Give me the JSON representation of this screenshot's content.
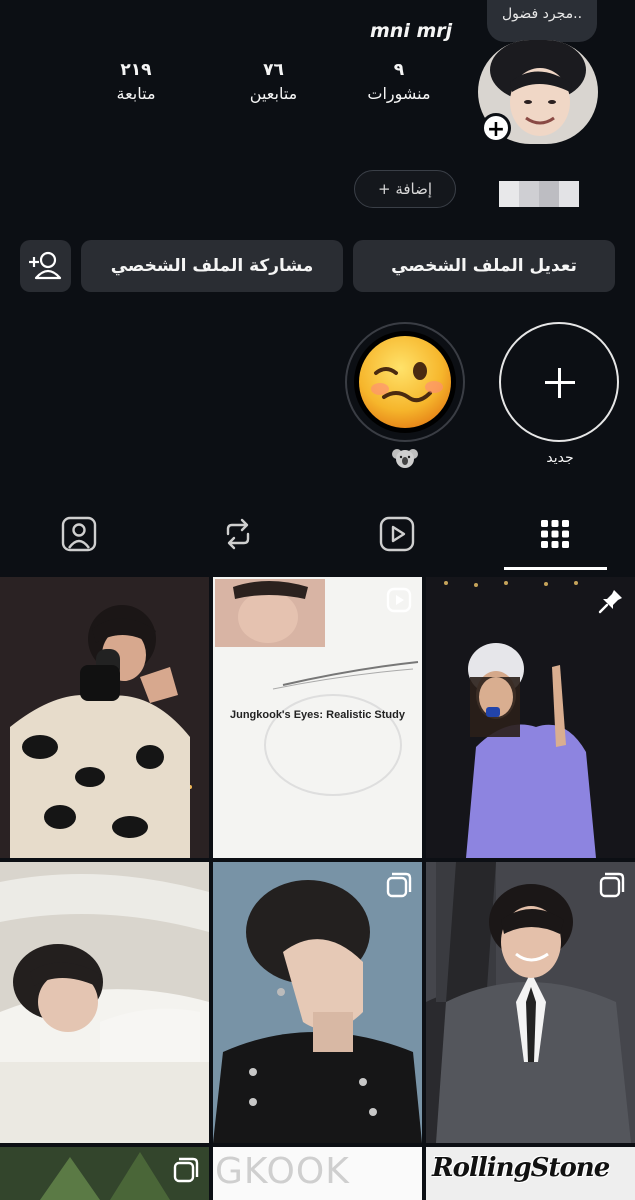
{
  "note": {
    "text": "مجرد فضول.."
  },
  "profile": {
    "username": "mni mrj",
    "stats": {
      "posts": {
        "count": "٩",
        "label": "منشورات"
      },
      "followers": {
        "count": "٧٦",
        "label": "متابعين"
      },
      "following": {
        "count": "٢١٩",
        "label": "متابعة"
      }
    },
    "add_label": "+ إضافة",
    "avatar_add": "+"
  },
  "actions": {
    "edit_profile": "تعديل الملف الشخصي",
    "share_profile": "مشاركة الملف الشخصي",
    "discover_icon": "add-person-icon"
  },
  "stories": {
    "new_label": "جديد",
    "highlight_label_icon": "koala-emoji"
  },
  "tabs": [
    {
      "name": "grid",
      "icon": "grid-icon",
      "active": true
    },
    {
      "name": "reels",
      "icon": "reels-icon",
      "active": false
    },
    {
      "name": "reposts",
      "icon": "repost-icon",
      "active": false
    },
    {
      "name": "tagged",
      "icon": "tagged-icon",
      "active": false
    }
  ],
  "posts": [
    {
      "type": "pinned",
      "badge": "pin-icon",
      "desc": "singer-on-stage"
    },
    {
      "type": "reel",
      "badge": "reel-icon",
      "caption": "Jungkook's Eyes: Realistic Study"
    },
    {
      "type": "photo",
      "badge": "",
      "desc": "singer-camo-jacket"
    },
    {
      "type": "carousel",
      "badge": "carousel-icon",
      "desc": "suit-portrait"
    },
    {
      "type": "carousel",
      "badge": "carousel-icon",
      "desc": "profile-portrait"
    },
    {
      "type": "photo",
      "badge": "",
      "desc": "lying-portrait"
    },
    {
      "type": "photo",
      "badge": "",
      "caption": "RollingStone"
    },
    {
      "type": "photo",
      "badge": "",
      "caption": "GKOOK"
    },
    {
      "type": "carousel",
      "badge": "carousel-icon",
      "desc": "tree-photo"
    }
  ],
  "colors": {
    "background": "#0c0f14",
    "button": "#2a2d33",
    "text": "#f5f5f5"
  }
}
